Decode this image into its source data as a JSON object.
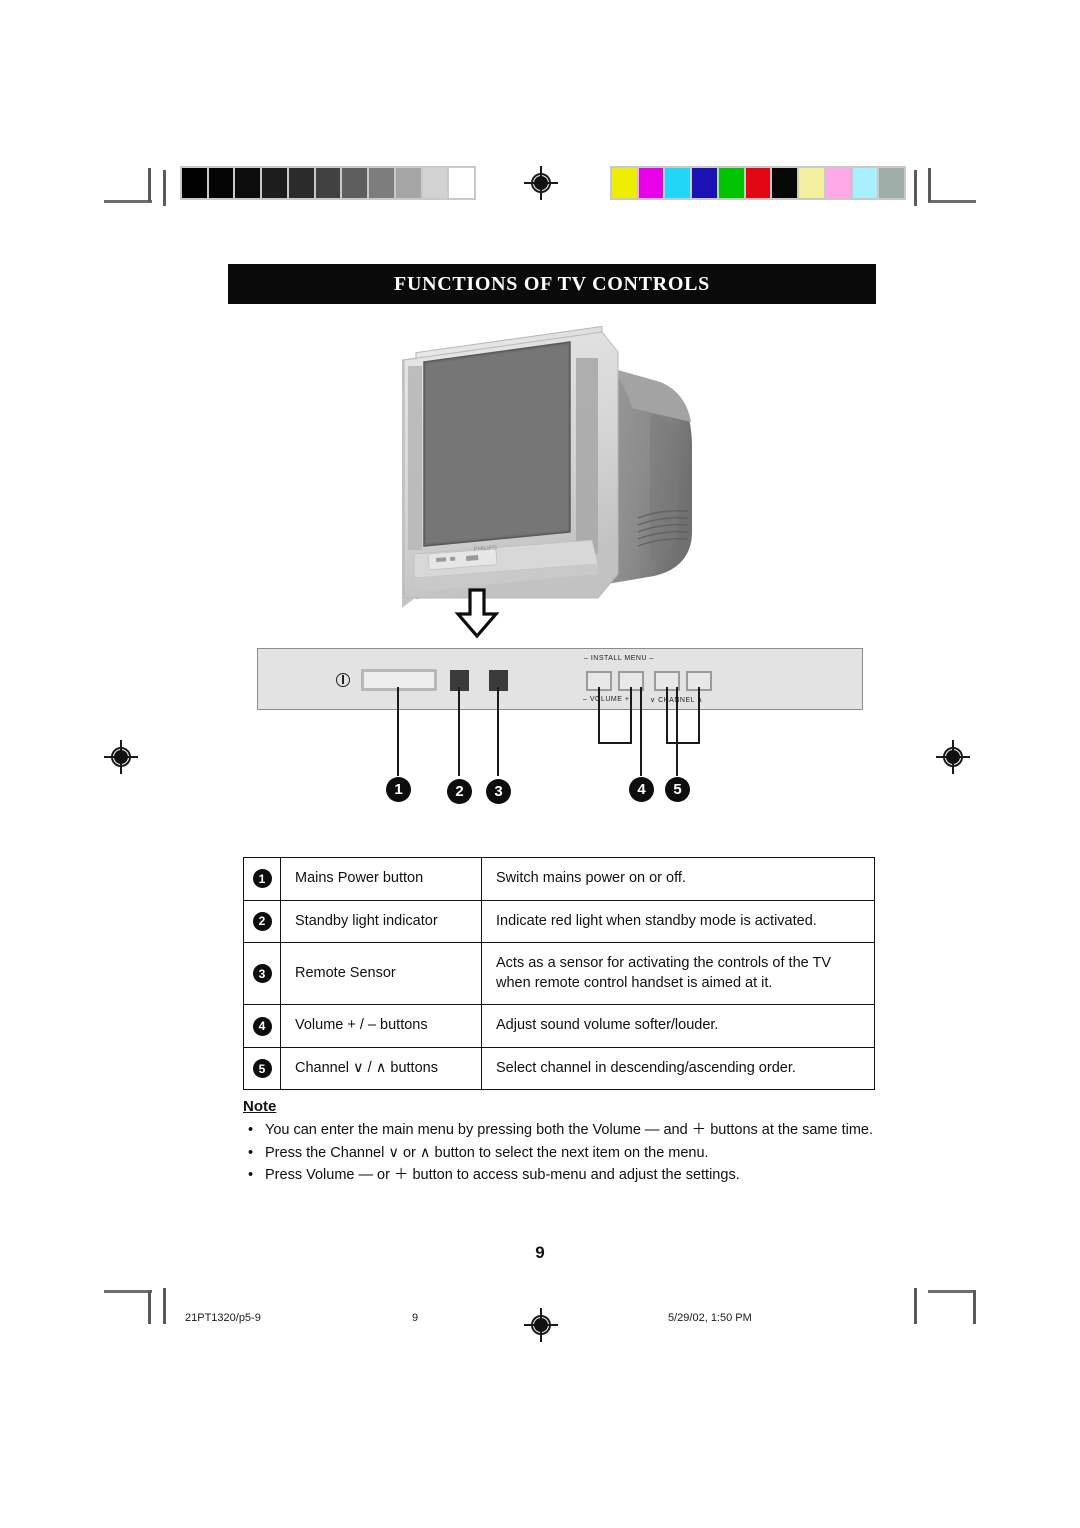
{
  "page": {
    "title": "FUNCTIONS OF TV CONTROLS",
    "page_number": "9"
  },
  "illustration": {
    "tv_alt": "crt-television",
    "arrow": "down-arrow"
  },
  "control_panel": {
    "power_symbol": "power-icon",
    "install_menu_label": "– INSTALL MENU –",
    "volume_label": "–  VOLUME  +",
    "channel_label": "∨  CHANNEL  ∧",
    "callouts": [
      "1",
      "2",
      "3",
      "4",
      "5"
    ]
  },
  "table": {
    "rows": [
      {
        "num": "1",
        "name": "Mains Power button",
        "desc": "Switch mains power on or off."
      },
      {
        "num": "2",
        "name": "Standby light indicator",
        "desc": "Indicate red light when standby mode is activated."
      },
      {
        "num": "3",
        "name": "Remote Sensor",
        "desc": "Acts as a sensor for activating the controls of the TV when remote control handset is aimed at it."
      },
      {
        "num": "4",
        "name": "Volume + / – buttons",
        "desc": "Adjust sound volume softer/louder."
      },
      {
        "num": "5",
        "name": "Channel ∨ / ∧ buttons",
        "desc": "Select channel in descending/ascending order."
      }
    ]
  },
  "note": {
    "heading": "Note",
    "bullet": "•",
    "items": [
      "You can enter the main menu by pressing both the Volume —  and ＋ buttons at the same time.",
      "Press the Channel ∨ or ∧ button to select the next item on the menu.",
      "Press Volume — or ＋ button to access sub-menu and adjust the settings."
    ]
  },
  "footer": {
    "file": "21PT1320/p5-9",
    "page": "9",
    "timestamp": "5/29/02, 1:50 PM"
  },
  "calibration": {
    "grayscale": [
      "#000000",
      "#050505",
      "#0c0c0c",
      "#1d1d1d",
      "#2b2b2b",
      "#414141",
      "#5e5e5e",
      "#7d7d7d",
      "#a5a5a5",
      "#d2d2d2",
      "#ffffff"
    ],
    "colors": [
      "#eeee00",
      "#e800e8",
      "#22d6f5",
      "#1b12b4",
      "#00c400",
      "#e30613",
      "#080808",
      "#f5f0a0",
      "#ffa8e8",
      "#a8f0ff",
      "#9fada8"
    ]
  }
}
